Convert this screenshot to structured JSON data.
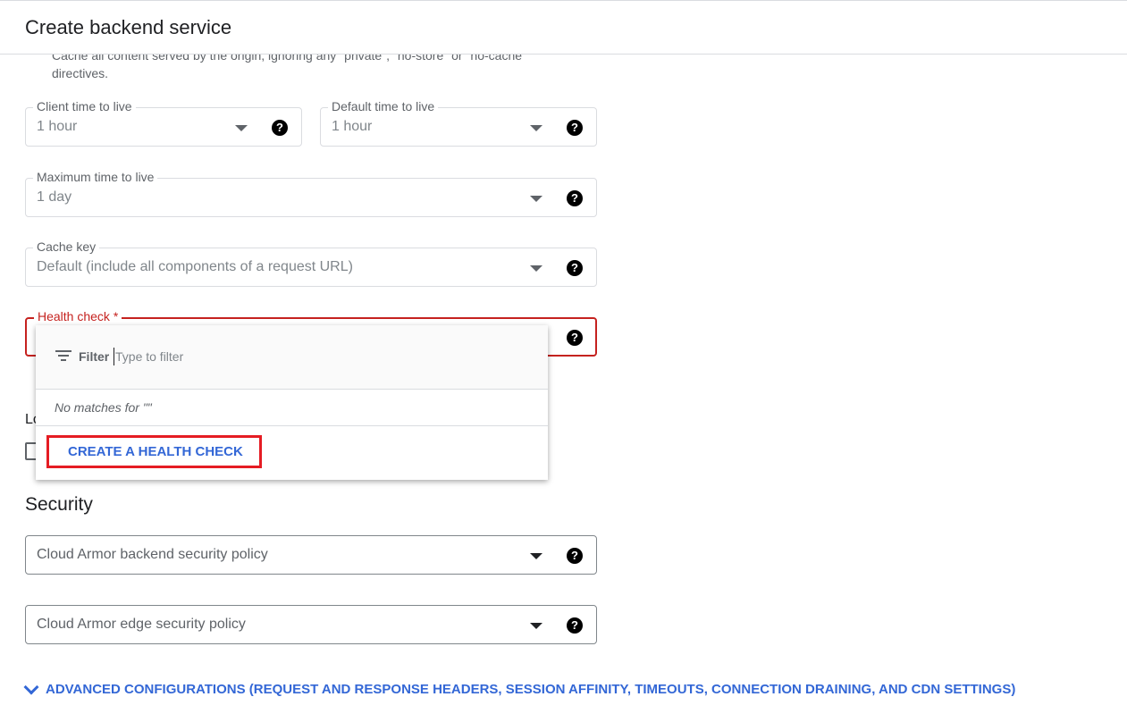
{
  "header": {
    "title": "Create backend service"
  },
  "cache_mode_description": "Cache all content served by the origin, ignoring any \"private\", \"no-store\" or \"no-cache\" directives.",
  "fields": {
    "client_ttl": {
      "label": "Client time to live",
      "value": "1 hour"
    },
    "default_ttl": {
      "label": "Default time to live",
      "value": "1 hour"
    },
    "max_ttl": {
      "label": "Maximum time to live",
      "value": "1 day"
    },
    "cache_key": {
      "label": "Cache key",
      "value": "Default (include all components of a request URL)"
    },
    "health_check": {
      "label": "Health check *"
    }
  },
  "help_glyph": "?",
  "dropdown": {
    "filter_label": "Filter",
    "filter_placeholder": "Type to filter",
    "no_matches": "No matches for \"\"",
    "create_label": "CREATE A HEALTH CHECK"
  },
  "logging_partial": "Lo",
  "security": {
    "title": "Security",
    "backend_policy": "Cloud Armor backend security policy",
    "edge_policy": "Cloud Armor edge security policy"
  },
  "advanced": {
    "label": "ADVANCED CONFIGURATIONS (REQUEST AND RESPONSE HEADERS, SESSION AFFINITY, TIMEOUTS, CONNECTION DRAINING, AND CDN SETTINGS)"
  },
  "colors": {
    "accent": "#3367d6",
    "error": "#c5221f",
    "highlight": "#e51c23"
  }
}
